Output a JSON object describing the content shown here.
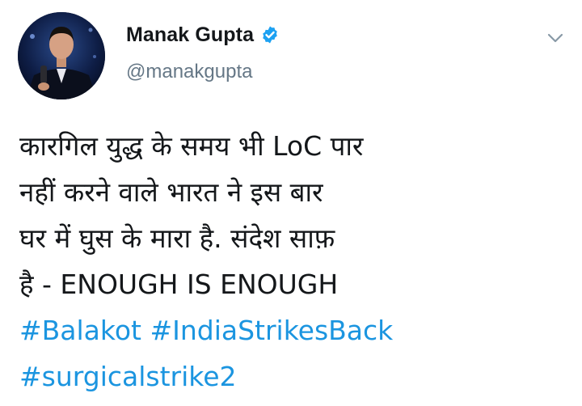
{
  "tweet": {
    "author": {
      "display_name": "Manak Gupta",
      "handle": "@manakgupta",
      "verified": true,
      "avatar": "avatar-icon"
    },
    "text_lines": [
      "कारगिल युद्ध के समय भी LoC पार",
      "नहीं करने वाले भारत ने इस बार",
      "घर में घुस के मारा है. संदेश साफ़",
      "है - ENOUGH IS ENOUGH"
    ],
    "hashtags": [
      "#Balakot",
      "#IndiaStrikesBack",
      "#surgicalstrike2"
    ],
    "icons": {
      "verified": "verified-badge-icon",
      "menu": "chevron-down-icon"
    },
    "colors": {
      "link": "#1b95e0",
      "verified": "#1da1f2",
      "text": "#14171a",
      "secondary": "#657786"
    }
  }
}
